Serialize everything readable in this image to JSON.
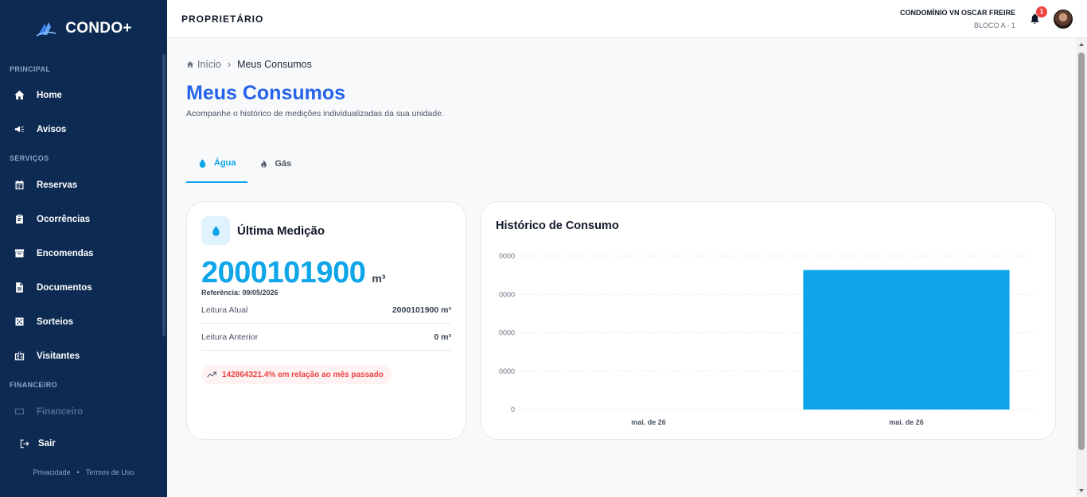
{
  "sidebar": {
    "brand": "CONDO+",
    "sections": [
      {
        "label": "PRINCIPAL",
        "items": [
          {
            "label": "Home",
            "icon": "home-icon"
          },
          {
            "label": "Avisos",
            "icon": "megaphone-icon"
          }
        ]
      },
      {
        "label": "SERVIÇOS",
        "items": [
          {
            "label": "Reservas",
            "icon": "calendar-icon"
          },
          {
            "label": "Ocorrências",
            "icon": "clipboard-icon"
          },
          {
            "label": "Encomendas",
            "icon": "package-icon"
          },
          {
            "label": "Documentos",
            "icon": "document-icon"
          },
          {
            "label": "Sorteios",
            "icon": "dice-icon"
          },
          {
            "label": "Visitantes",
            "icon": "visitor-badge-icon"
          }
        ]
      },
      {
        "label": "FINANCEIRO",
        "items": [
          {
            "label": "Financeiro",
            "icon": "finance-icon"
          }
        ]
      }
    ],
    "logout": "Sair",
    "footer_links": [
      "Privacidade",
      "•",
      "Termos de Uso"
    ]
  },
  "topbar": {
    "role": "PROPRIETÁRIO",
    "condo_name": "CONDOMÍNIO VN OSCAR FREIRE",
    "condo_block": "BLOCO A - 1",
    "notification_count": "1"
  },
  "breadcrumb": {
    "home": "Início",
    "separator": "›",
    "current": "Meus Consumos"
  },
  "page": {
    "title": "Meus Consumos",
    "subtitle": "Acompanhe o histórico de medições individualizadas da sua unidade."
  },
  "tabs": [
    {
      "label": "Água",
      "icon": "water-drop-icon",
      "active": true
    },
    {
      "label": "Gás",
      "icon": "flame-icon",
      "active": false
    }
  ],
  "reading_card": {
    "title": "Última Medição",
    "value": "2000101900",
    "unit": "m³",
    "reference": "Referência: 09/05/2026",
    "rows": [
      {
        "label": "Leitura Atual",
        "value": "2000101900 m³"
      },
      {
        "label": "Leitura Anterior",
        "value": "0 m³"
      }
    ],
    "change": "142864321.4% em relação ao mês passado",
    "change_color": "#ef4444"
  },
  "chart_data": {
    "type": "bar",
    "title": "Histórico de Consumo",
    "categories": [
      "mai. de 26",
      "mai. de 26"
    ],
    "values": [
      0,
      2000101900
    ],
    "y_tick_labels": [
      "0",
      "0000",
      "0000",
      "0000",
      "0000"
    ],
    "ylim": [
      0,
      2200000000
    ],
    "grid": true,
    "bar_color": "#0ea5e9"
  }
}
